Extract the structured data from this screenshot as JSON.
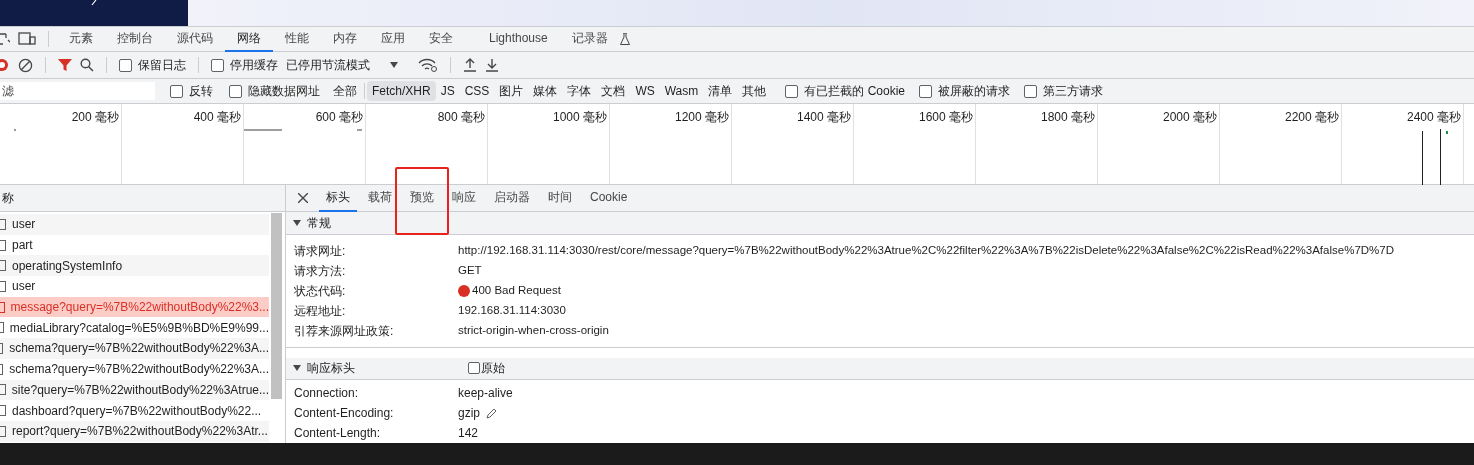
{
  "panel_tabs": [
    {
      "label": "元素",
      "selected": false
    },
    {
      "label": "控制台",
      "selected": false
    },
    {
      "label": "源代码",
      "selected": false
    },
    {
      "label": "网络",
      "selected": true
    },
    {
      "label": "性能",
      "selected": false
    },
    {
      "label": "内存",
      "selected": false
    },
    {
      "label": "应用",
      "selected": false
    },
    {
      "label": "安全",
      "selected": false
    },
    {
      "label": "Lighthouse",
      "selected": false
    },
    {
      "label": "记录器",
      "selected": false
    }
  ],
  "toolbar": {
    "recording": true,
    "filter_active": true,
    "checkboxes": [
      {
        "label": "保留日志",
        "checked": false
      },
      {
        "label": "停用缓存",
        "checked": false
      }
    ],
    "throttling": "已停用节流模式"
  },
  "filter_bar": {
    "placeholder": "滤",
    "checkboxes": [
      {
        "label": "反转",
        "checked": false
      },
      {
        "label": "隐藏数据网址",
        "checked": false
      }
    ],
    "types": [
      {
        "label": "全部",
        "selected": false
      },
      {
        "label": "Fetch/XHR",
        "selected": true
      },
      {
        "label": "JS",
        "selected": false
      },
      {
        "label": "CSS",
        "selected": false
      },
      {
        "label": "图片",
        "selected": false
      },
      {
        "label": "媒体",
        "selected": false
      },
      {
        "label": "字体",
        "selected": false
      },
      {
        "label": "文档",
        "selected": false
      },
      {
        "label": "WS",
        "selected": false
      },
      {
        "label": "Wasm",
        "selected": false
      },
      {
        "label": "清单",
        "selected": false
      },
      {
        "label": "其他",
        "selected": false
      }
    ],
    "more_checkboxes": [
      {
        "label": "有已拦截的 Cookie",
        "checked": false
      },
      {
        "label": "被屏蔽的请求",
        "checked": false
      },
      {
        "label": "第三方请求",
        "checked": false
      }
    ]
  },
  "timeline": {
    "ticks": [
      "200 毫秒",
      "400 毫秒",
      "600 毫秒",
      "800 毫秒",
      "1000 毫秒",
      "1200 毫秒",
      "1400 毫秒",
      "1600 毫秒",
      "1800 毫秒",
      "2000 毫秒",
      "2200 毫秒",
      "2400 毫秒"
    ]
  },
  "requests": {
    "header": "称",
    "rows": [
      {
        "name": "user",
        "selected": false,
        "error": false
      },
      {
        "name": "part",
        "selected": false,
        "error": false
      },
      {
        "name": "operatingSystemInfo",
        "selected": false,
        "error": false
      },
      {
        "name": "user",
        "selected": false,
        "error": false
      },
      {
        "name": "message?query=%7B%22withoutBody%22%3...",
        "selected": true,
        "error": true
      },
      {
        "name": "mediaLibrary?catalog=%E5%9B%BD%E9%99...",
        "selected": false,
        "error": false
      },
      {
        "name": "schema?query=%7B%22withoutBody%22%3A...",
        "selected": false,
        "error": false
      },
      {
        "name": "schema?query=%7B%22withoutBody%22%3A...",
        "selected": false,
        "error": false
      },
      {
        "name": "site?query=%7B%22withoutBody%22%3Atrue...",
        "selected": false,
        "error": false
      },
      {
        "name": "dashboard?query=%7B%22withoutBody%22...",
        "selected": false,
        "error": false
      },
      {
        "name": "report?query=%7B%22withoutBody%22%3Atr...",
        "selected": false,
        "error": false
      }
    ]
  },
  "detail_tabs": [
    {
      "label": "标头",
      "selected": true,
      "highlighted": false
    },
    {
      "label": "载荷",
      "selected": false,
      "highlighted": false
    },
    {
      "label": "预览",
      "selected": false,
      "highlighted": true
    },
    {
      "label": "响应",
      "selected": false,
      "highlighted": false
    },
    {
      "label": "启动器",
      "selected": false,
      "highlighted": false
    },
    {
      "label": "时间",
      "selected": false,
      "highlighted": false
    },
    {
      "label": "Cookie",
      "selected": false,
      "highlighted": false
    }
  ],
  "general": {
    "title": "常规",
    "expanded": true,
    "rows": [
      {
        "label": "请求网址:",
        "value": "http://192.168.31.114:3030/rest/core/message?query=%7B%22withoutBody%22%3Atrue%2C%22filter%22%3A%7B%22isDelete%22%3Afalse%2C%22isRead%22%3Afalse%7D%7D",
        "kind": "text"
      },
      {
        "label": "请求方法:",
        "value": "GET",
        "kind": "text"
      },
      {
        "label": "状态代码:",
        "value": "400 Bad Request",
        "kind": "status",
        "color": "#d93025"
      },
      {
        "label": "远程地址:",
        "value": "192.168.31.114:3030",
        "kind": "text"
      },
      {
        "label": "引荐来源网址政策:",
        "value": "strict-origin-when-cross-origin",
        "kind": "text"
      }
    ]
  },
  "response_headers": {
    "title": "响应标头",
    "expanded": true,
    "raw": {
      "label": "原始",
      "checked": false
    },
    "rows": [
      {
        "label": "Connection:",
        "value": "keep-alive",
        "editable": false
      },
      {
        "label": "Content-Encoding:",
        "value": "gzip",
        "editable": true
      },
      {
        "label": "Content-Length:",
        "value": "142",
        "editable": false
      }
    ]
  }
}
